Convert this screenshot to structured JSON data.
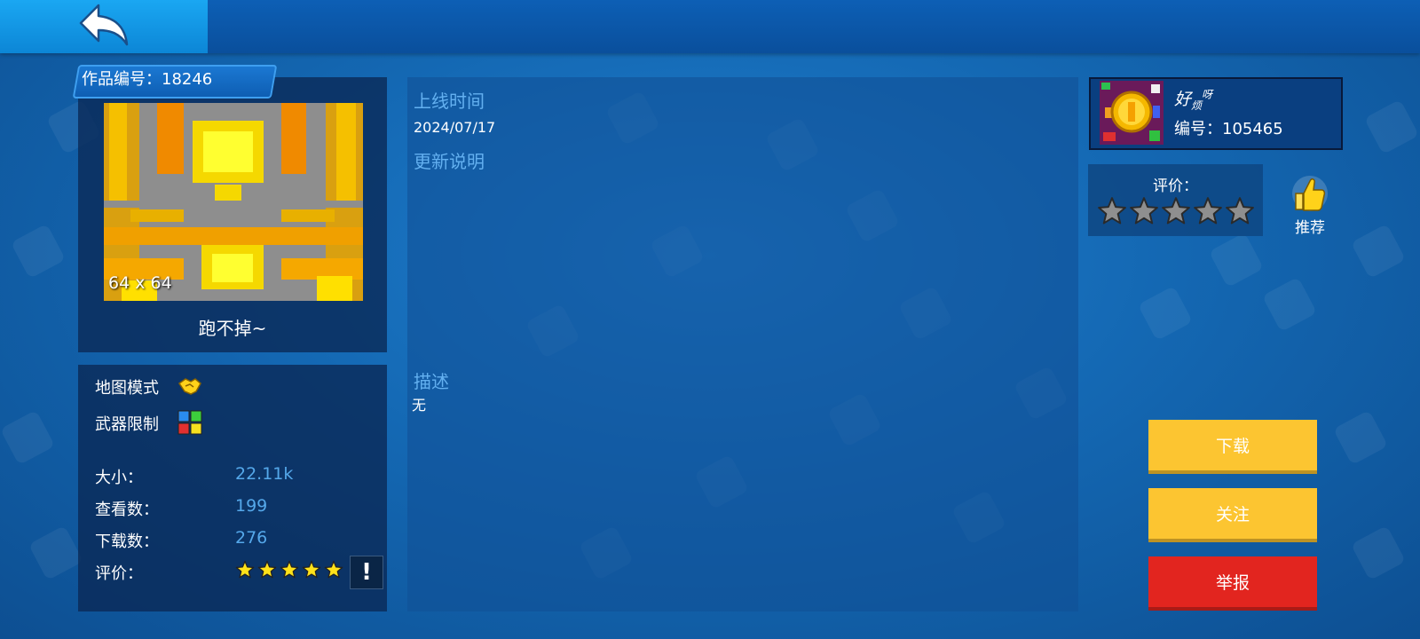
{
  "header": {
    "back_icon": "back-arrow-icon"
  },
  "work": {
    "id_label": "作品编号：18246",
    "size_overlay": "64 x 64",
    "name": "跑不掉~"
  },
  "details": {
    "map_mode_label": "地图模式",
    "map_mode_icon": "handshake-icon",
    "weapon_limit_label": "武器限制",
    "weapon_limit_icon": "weapon-grid-icon",
    "size_label": "大小：",
    "size_value": "22.11k",
    "views_label": "查看数：",
    "views_value": "199",
    "downloads_label": "下载数：",
    "downloads_value": "276",
    "rating_label": "评价：",
    "rating_stars": 5,
    "report_icon_text": "!"
  },
  "main": {
    "online_time_heading": "上线时间",
    "online_time_value": "2024/07/17",
    "update_notes_heading": "更新说明",
    "update_notes_value": "",
    "description_heading": "描述",
    "description_value": "无"
  },
  "author": {
    "name_main": "好",
    "name_sub": "烦",
    "name_sup": "呀",
    "id_label": "编号：105465",
    "avatar_icon": "coin-avatar-icon"
  },
  "rate": {
    "label": "评价：",
    "stars_filled": 0,
    "stars_total": 5,
    "recommend_label": "推荐",
    "recommend_icon": "thumbs-up-icon"
  },
  "actions": {
    "download_label": "下载",
    "follow_label": "关注",
    "report_label": "举报"
  },
  "colors": {
    "accent_blue": "#55a8ea",
    "button_yellow": "#fcc531",
    "button_red": "#e2251f"
  }
}
